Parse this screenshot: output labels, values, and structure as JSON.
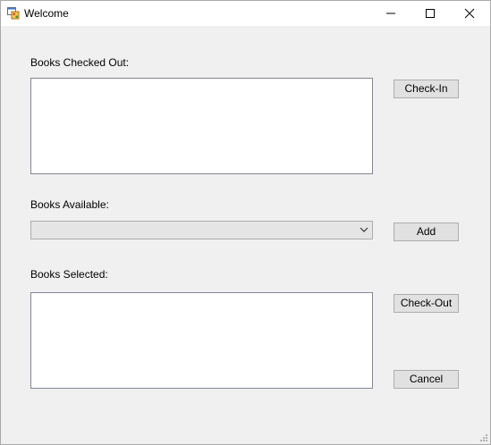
{
  "window": {
    "title": "Welcome",
    "icon": "app-form-icon",
    "controls": [
      "minimize-icon",
      "maximize-icon",
      "close-icon"
    ]
  },
  "checked_out": {
    "label": "Books Checked Out:",
    "items": []
  },
  "available": {
    "label": "Books Available:",
    "selected_value": "",
    "options": []
  },
  "selected": {
    "label": "Books Selected:",
    "items": []
  },
  "buttons": {
    "check_in": "Check-In",
    "add": "Add",
    "check_out": "Check-Out",
    "cancel": "Cancel"
  }
}
